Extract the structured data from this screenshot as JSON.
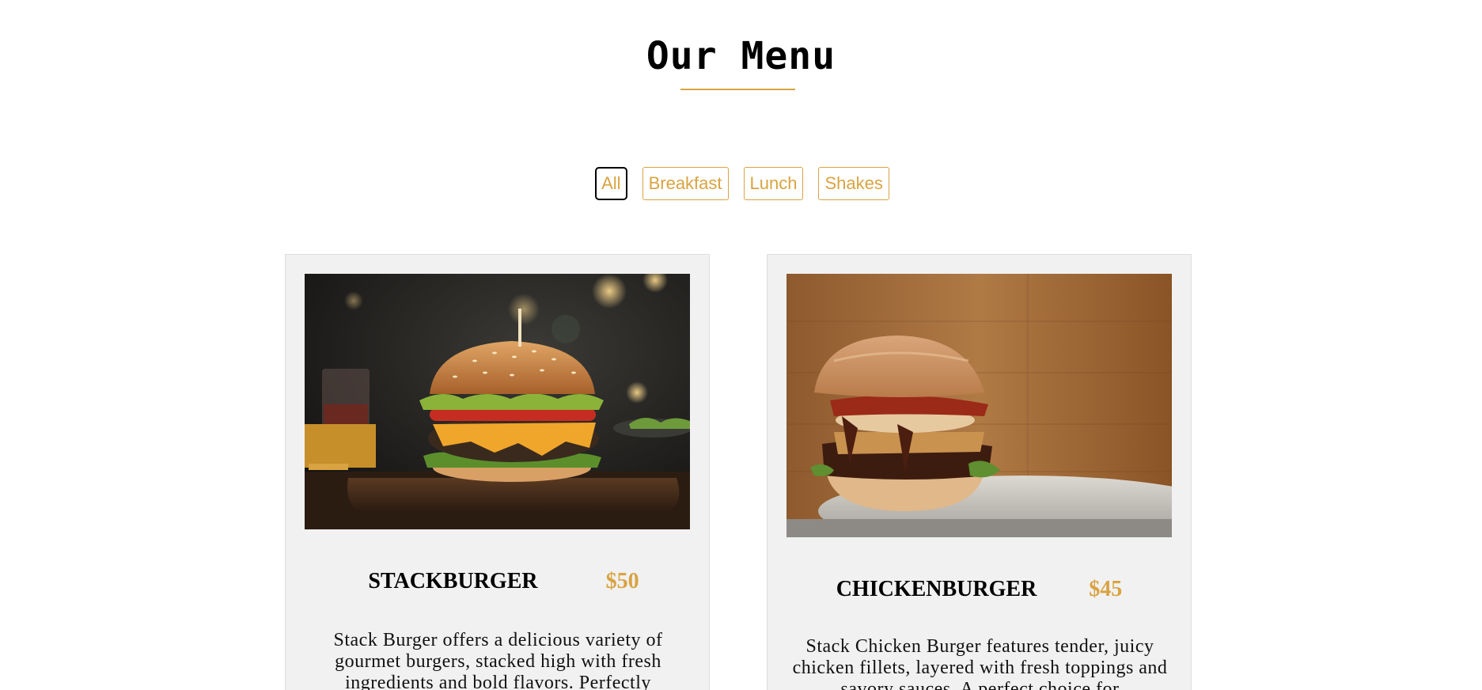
{
  "header": {
    "title": "Our Menu"
  },
  "filters": [
    {
      "label": "All",
      "active": true
    },
    {
      "label": "Breakfast",
      "active": false
    },
    {
      "label": "Lunch",
      "active": false
    },
    {
      "label": "Shakes",
      "active": false
    }
  ],
  "menu_items": [
    {
      "name": "STACKBURGER",
      "price": "$50",
      "description": "Stack Burger offers a delicious variety of gourmet burgers, stacked high with fresh ingredients and bold flavors. Perfectly"
    },
    {
      "name": "CHICKENBURGER",
      "price": "$45",
      "description": "Stack Chicken Burger features tender, juicy chicken fillets, layered with fresh toppings and savory sauces. A perfect choice for"
    }
  ],
  "colors": {
    "accent": "#d9a341",
    "card_background": "#f1f1f1",
    "text": "#000000"
  }
}
